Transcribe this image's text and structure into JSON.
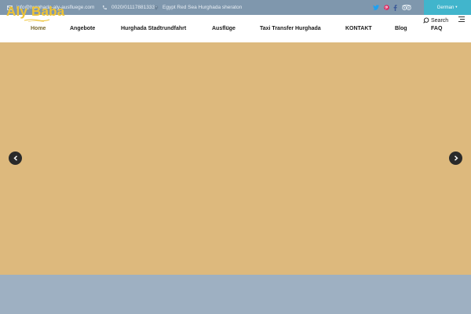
{
  "topbar": {
    "email": "info@hurghada-aly-ausfluege.com",
    "phone": "0020/01117881333",
    "location": "Egypt Red Sea Hurghada sheraton",
    "language": "German",
    "social_icons": [
      "twitter-icon",
      "pinterest-icon",
      "facebook-icon",
      "tripadvisor-icon"
    ]
  },
  "logo": {
    "text": "Aly Baba"
  },
  "nav": {
    "items": [
      {
        "label": "Home"
      },
      {
        "label": "Angebote"
      },
      {
        "label": "Hurghada Stadtrundfahrt"
      },
      {
        "label": "Ausflüge"
      },
      {
        "label": "Taxi Transfer Hurghada"
      },
      {
        "label": "KONTAKT"
      },
      {
        "label": "Blog"
      },
      {
        "label": "FAQ"
      }
    ],
    "search_label": "Search"
  },
  "hero": {
    "background_color": "#ddb97d"
  },
  "colors": {
    "topbar": "#7f97ad",
    "language_button": "#41b5cc",
    "logo": "#eec334"
  }
}
